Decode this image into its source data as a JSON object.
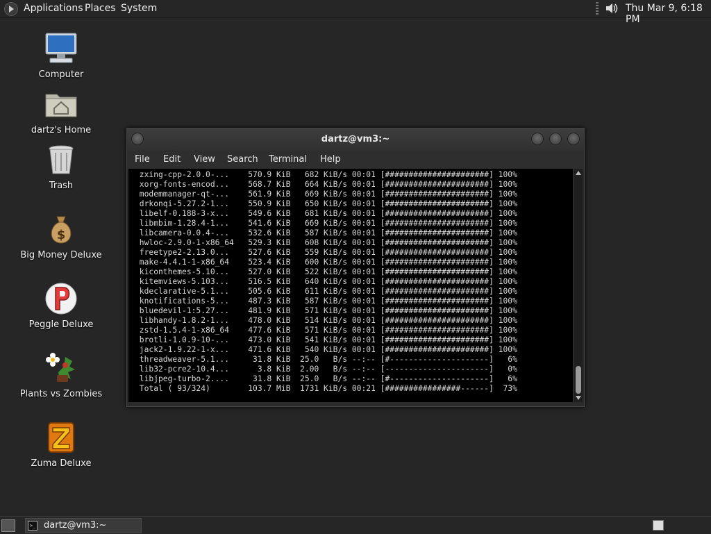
{
  "top_panel": {
    "menus": [
      "Applications",
      "Places",
      "System"
    ],
    "clock": "Thu Mar  9,  6:18 PM",
    "volume_icon": "speaker-icon"
  },
  "desktop_icons": [
    {
      "label": "Computer",
      "icon": "computer-icon"
    },
    {
      "label": "dartz's Home",
      "icon": "home-folder-icon"
    },
    {
      "label": "Trash",
      "icon": "trash-icon"
    },
    {
      "label": "Big Money Deluxe",
      "icon": "money-bag-icon"
    },
    {
      "label": "Peggle Deluxe",
      "icon": "peggle-icon"
    },
    {
      "label": "Plants vs Zombies",
      "icon": "plants-vs-zombies-icon"
    },
    {
      "label": "Zuma Deluxe",
      "icon": "zuma-icon"
    }
  ],
  "terminal": {
    "title": "dartz@vm3:~",
    "menu": [
      "File",
      "Edit",
      "View",
      "Search",
      "Terminal",
      "Help"
    ],
    "lines": [
      " zxing-cpp-2.0.0-...    570.9 KiB   682 KiB/s 00:01 [######################] 100%",
      " xorg-fonts-encod...    568.7 KiB   664 KiB/s 00:01 [######################] 100%",
      " modemmanager-qt-...    561.9 KiB   669 KiB/s 00:01 [######################] 100%",
      " drkonqi-5.27.2-1...    550.9 KiB   650 KiB/s 00:01 [######################] 100%",
      " libelf-0.188-3-x...    549.6 KiB   681 KiB/s 00:01 [######################] 100%",
      " libmbim-1.28.4-1...    541.6 KiB   669 KiB/s 00:01 [######################] 100%",
      " libcamera-0.0.4-...    532.6 KiB   587 KiB/s 00:01 [######################] 100%",
      " hwloc-2.9.0-1-x86_64   529.3 KiB   608 KiB/s 00:01 [######################] 100%",
      " freetype2-2.13.0...    527.6 KiB   559 KiB/s 00:01 [######################] 100%",
      " make-4.4.1-1-x86_64    523.4 KiB   600 KiB/s 00:01 [######################] 100%",
      " kiconthemes-5.10...    527.0 KiB   522 KiB/s 00:01 [######################] 100%",
      " kitemviews-5.103...    516.5 KiB   640 KiB/s 00:01 [######################] 100%",
      " kdeclarative-5.1...    505.6 KiB   611 KiB/s 00:01 [######################] 100%",
      " knotifications-5...    487.3 KiB   587 KiB/s 00:01 [######################] 100%",
      " bluedevil-1:5.27...    481.9 KiB   571 KiB/s 00:01 [######################] 100%",
      " libhandy-1.8.2-1...    478.0 KiB   514 KiB/s 00:01 [######################] 100%",
      " zstd-1.5.4-1-x86_64    477.6 KiB   571 KiB/s 00:01 [######################] 100%",
      " brotli-1.0.9-10-...    473.0 KiB   541 KiB/s 00:01 [######################] 100%",
      " jack2-1.9.22-1-x...    471.6 KiB   540 KiB/s 00:01 [######################] 100%",
      " threadweaver-5.1...     31.8 KiB  25.0   B/s --:-- [#---------------------]   6%",
      " lib32-pcre2-10.4...      3.8 KiB  2.00   B/s --:-- [----------------------]   0%",
      " libjpeg-turbo-2....     31.8 KiB  25.0   B/s --:-- [#---------------------]   6%",
      " Total ( 93/324)        103.7 MiB  1731 KiB/s 00:21 [################------]  73%"
    ]
  },
  "taskbar": {
    "task_label": "dartz@vm3:~"
  }
}
